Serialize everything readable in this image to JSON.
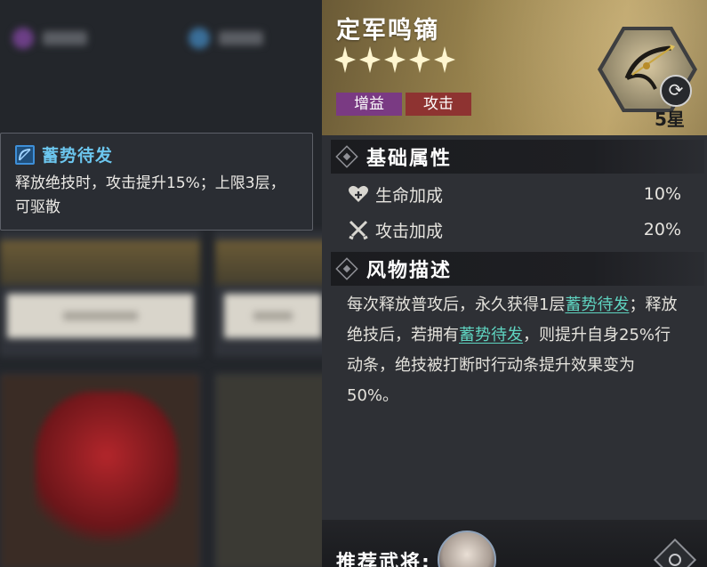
{
  "tooltip": {
    "title": "蓄势待发",
    "description": "释放绝技时，攻击提升15%；上限3层，可驱散"
  },
  "item": {
    "name": "定军鸣镝",
    "star_count": 5,
    "level": "5星",
    "tags": [
      {
        "label": "增益",
        "color": "#7a3a83"
      },
      {
        "label": "攻击",
        "color": "#8e3331"
      }
    ]
  },
  "sections": {
    "base_attributes": {
      "title": "基础属性",
      "rows": [
        {
          "icon": "heart-plus-icon",
          "label": "生命加成",
          "value": "10%"
        },
        {
          "icon": "crossed-swords-icon",
          "label": "攻击加成",
          "value": "20%"
        }
      ]
    },
    "description": {
      "title": "风物描述",
      "parts": [
        {
          "text": "每次释放普攻后，永久获得1层"
        },
        {
          "text": "蓄势待发",
          "highlight": true
        },
        {
          "text": "；释放绝技后，若拥有"
        },
        {
          "text": "蓄势待发",
          "highlight": true
        },
        {
          "text": "，则提升自身25%行动条，绝技被打断时行动条提升效果变为50%。"
        }
      ]
    }
  },
  "footer": {
    "recommend_label": "推荐武将:"
  },
  "colors": {
    "highlight": "#5fd3c0",
    "tooltip_title": "#6cc6ee",
    "header_gold": "#b59b5f"
  }
}
